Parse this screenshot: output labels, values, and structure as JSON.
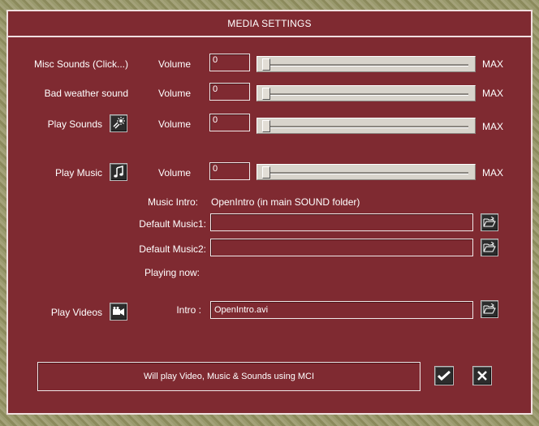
{
  "dialog": {
    "title": "MEDIA SETTINGS"
  },
  "rows": [
    {
      "label": "Misc Sounds (Click...)",
      "volume_label": "Volume",
      "value": "0",
      "max_label": "MAX",
      "level": 0
    },
    {
      "label": "Bad weather sound",
      "volume_label": "Volume",
      "value": "0",
      "max_label": "MAX",
      "level": 0
    },
    {
      "label": "Play Sounds",
      "volume_label": "Volume",
      "value": "0",
      "max_label": "MAX",
      "level": 0
    },
    {
      "label": "Play Music",
      "volume_label": "Volume",
      "value": "0",
      "max_label": "MAX",
      "level": 0
    }
  ],
  "music": {
    "intro_label": "Music Intro:",
    "intro_value": "OpenIntro  (in main SOUND folder)",
    "default1_label": "Default Music1:",
    "default1_value": "",
    "default2_label": "Default Music2:",
    "default2_value": "",
    "playing_now_label": "Playing now:"
  },
  "video": {
    "label": "Play Videos",
    "intro_label": "Intro :",
    "intro_value": "OpenIntro.avi"
  },
  "status": {
    "text": "Will play Video, Music & Sounds using  MCI"
  },
  "icons": {
    "play_sounds": "speaker-sparkle-icon",
    "play_music": "music-note-icon",
    "play_videos": "video-camera-icon",
    "browse": "open-folder-icon",
    "ok": "checkmark-icon",
    "cancel": "close-icon"
  },
  "colors": {
    "panel": "#7f2a31",
    "border": "#f0e0e0",
    "text": "#ffffff"
  }
}
